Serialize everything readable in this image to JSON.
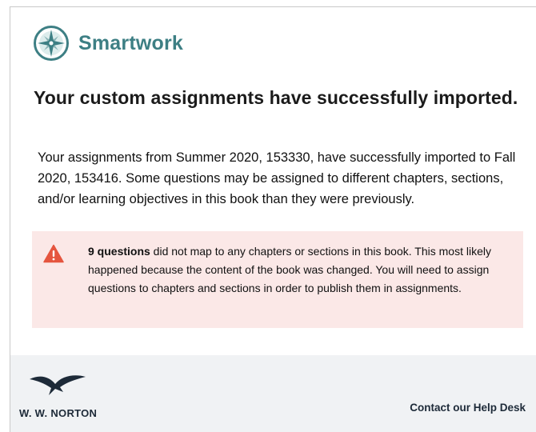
{
  "brand": {
    "icon": "compass-rose-icon",
    "name": "Smartwork",
    "color": "#3d7f84"
  },
  "title": "Your custom assignments have successfully imported.",
  "message": "Your assignments from Summer 2020, 153330, have successfully imported to Fall 2020, 153416. Some questions may be assigned to different chapters, sections, and/or learning objectives in this book than they were previously.",
  "alert": {
    "icon": "warning-triangle-icon",
    "bold_text": "9 questions",
    "text": " did not map to any chapters or sections in this book. This most likely happened because the content of the book was changed. You will need to assign questions to chapters and sections in order to publish them in assignments.",
    "background": "#fbe8e7",
    "icon_color": "#e5553f"
  },
  "footer": {
    "logo_icon": "seagull-icon",
    "publisher": "W. W. NORTON",
    "help_link": "Contact our Help Desk"
  }
}
